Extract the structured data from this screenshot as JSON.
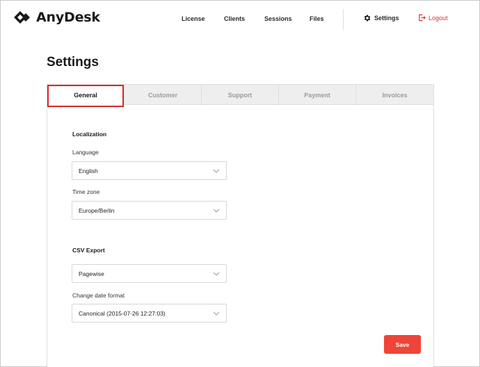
{
  "app": {
    "brand": "AnyDesk",
    "brand_color": "#1a1a1a",
    "accent_color": "#ef4437"
  },
  "nav": {
    "links": [
      "License",
      "Clients",
      "Sessions",
      "Files"
    ],
    "settings_label": "Settings",
    "settings_icon": "gear-icon",
    "logout_label": "Logout",
    "logout_icon": "logout-icon"
  },
  "page": {
    "title": "Settings"
  },
  "tabs": [
    {
      "label": "General",
      "active": true
    },
    {
      "label": "Customer",
      "active": false
    },
    {
      "label": "Support",
      "active": false
    },
    {
      "label": "Payment",
      "active": false
    },
    {
      "label": "Invoices",
      "active": false
    }
  ],
  "localization": {
    "title": "Localization",
    "language_label": "Language",
    "language_value": "English",
    "timezone_label": "Time zone",
    "timezone_value": "Europe/Berlin"
  },
  "csv_export": {
    "title": "CSV Export",
    "mode_value": "Pagewise",
    "date_format_label": "Change date format",
    "date_format_value": "Canonical (2015-07-26 12:27:03)"
  },
  "actions": {
    "save_label": "Save"
  }
}
